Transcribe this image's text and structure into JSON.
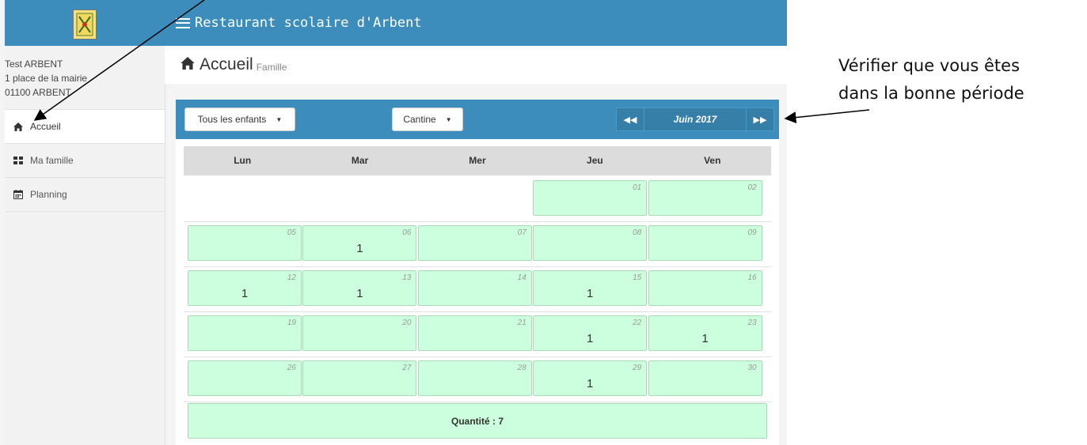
{
  "app": {
    "title": "Restaurant scolaire d'Arbent"
  },
  "user": {
    "name": "Test ARBENT",
    "address": "1 place de la mairie",
    "city": "01100 ARBENT"
  },
  "sidebar": {
    "items": [
      {
        "label": "Accueil",
        "icon": "home-icon"
      },
      {
        "label": "Ma famille",
        "icon": "grid-icon"
      },
      {
        "label": "Planning",
        "icon": "calendar-icon"
      }
    ]
  },
  "page": {
    "title": "Accueil",
    "subtitle": "Famille"
  },
  "filters": {
    "children": "Tous les enfants",
    "service": "Cantine"
  },
  "calendar": {
    "month": "Juin 2017",
    "weekdays": [
      "Lun",
      "Mar",
      "Mer",
      "Jeu",
      "Ven"
    ],
    "weeks": [
      [
        {
          "day": "",
          "qty": ""
        },
        {
          "day": "",
          "qty": ""
        },
        {
          "day": "",
          "qty": ""
        },
        {
          "day": "01",
          "qty": ""
        },
        {
          "day": "02",
          "qty": ""
        }
      ],
      [
        {
          "day": "05",
          "qty": ""
        },
        {
          "day": "06",
          "qty": "1"
        },
        {
          "day": "07",
          "qty": ""
        },
        {
          "day": "08",
          "qty": ""
        },
        {
          "day": "09",
          "qty": ""
        }
      ],
      [
        {
          "day": "12",
          "qty": "1"
        },
        {
          "day": "13",
          "qty": "1"
        },
        {
          "day": "14",
          "qty": ""
        },
        {
          "day": "15",
          "qty": "1"
        },
        {
          "day": "16",
          "qty": ""
        }
      ],
      [
        {
          "day": "19",
          "qty": ""
        },
        {
          "day": "20",
          "qty": ""
        },
        {
          "day": "21",
          "qty": ""
        },
        {
          "day": "22",
          "qty": "1"
        },
        {
          "day": "23",
          "qty": "1"
        }
      ],
      [
        {
          "day": "26",
          "qty": ""
        },
        {
          "day": "27",
          "qty": ""
        },
        {
          "day": "28",
          "qty": ""
        },
        {
          "day": "29",
          "qty": "1"
        },
        {
          "day": "30",
          "qty": ""
        }
      ]
    ],
    "total": "Quantité : 7"
  },
  "annotation": {
    "line1": "Vérifier que vous êtes",
    "line2": "dans la bonne période"
  },
  "colors": {
    "primary": "#3c8dbc",
    "cell": "#ccffdd"
  }
}
